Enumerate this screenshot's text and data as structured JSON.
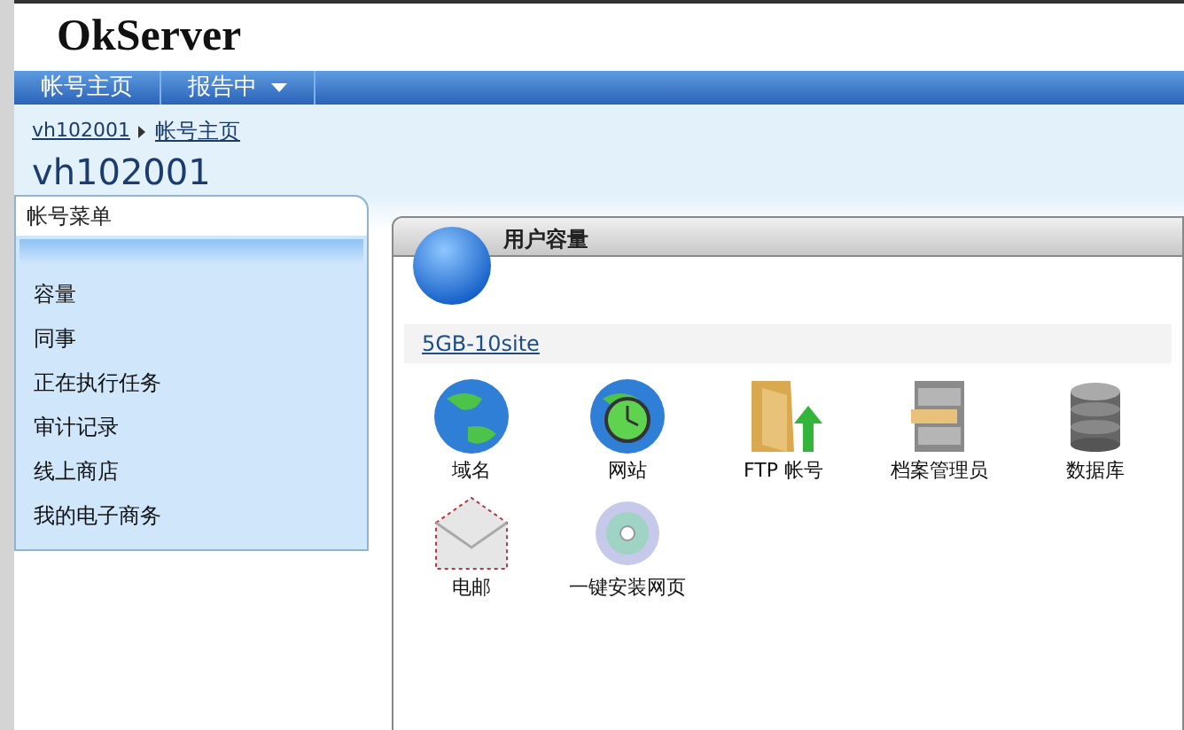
{
  "logo": {
    "text": "OkServer"
  },
  "nav": [
    {
      "label": "帐号主页",
      "dropdown": false
    },
    {
      "label": "报告中",
      "dropdown": true
    }
  ],
  "breadcrumb": [
    {
      "label": "vh102001"
    },
    {
      "label": "帐号主页"
    }
  ],
  "page_title": "vh102001",
  "sidebar": {
    "title": "帐号菜单",
    "items": [
      "容量",
      "同事",
      "正在执行任务",
      "审计记录",
      "线上商店",
      "我的电子商务"
    ]
  },
  "panel": {
    "title": "用户容量",
    "plan": "5GB-10site",
    "items": [
      {
        "kind": "globe",
        "label": "域名"
      },
      {
        "kind": "website",
        "label": "网站"
      },
      {
        "kind": "ftp",
        "label": "FTP 帐号"
      },
      {
        "kind": "cabinet",
        "label": "档案管理员"
      },
      {
        "kind": "database",
        "label": "数据库"
      },
      {
        "kind": "mail",
        "label": "电邮"
      },
      {
        "kind": "disc",
        "label": "一键安装网页"
      }
    ]
  }
}
